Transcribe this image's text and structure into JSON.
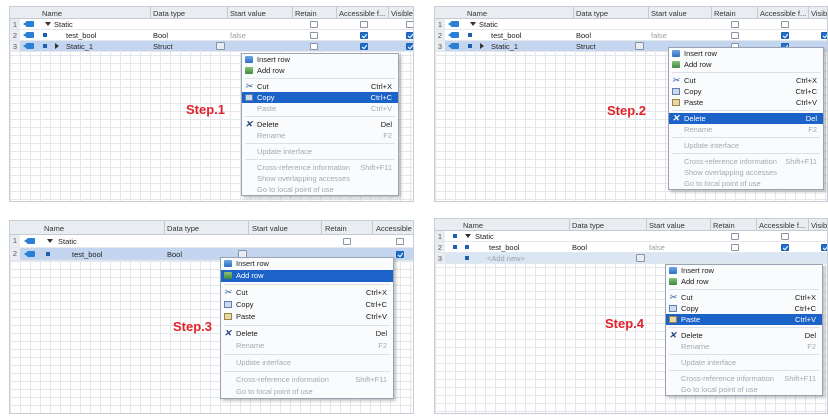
{
  "headers": {
    "name": "Name",
    "data_type": "Data type",
    "start_value": "Start value",
    "retain": "Retain",
    "accessible": "Accessible f...",
    "accessible_p3": "Accessible",
    "visible": "Visible"
  },
  "rows": {
    "static": "Static",
    "test_bool": "test_bool",
    "bool": "Bool",
    "false": "false",
    "static_1": "Static_1",
    "struct": "Struct",
    "add_new": "<Add new>",
    "n1": "1",
    "n2": "2",
    "n3": "3"
  },
  "menu": {
    "insert_row": "Insert row",
    "add_row": "Add row",
    "cut": "Cut",
    "cut_sc": "Ctrl+X",
    "copy": "Copy",
    "copy_sc": "Ctrl+C",
    "paste": "Paste",
    "paste_sc": "Ctrl+V",
    "delete": "Delete",
    "delete_sc": "Del",
    "rename": "Rename",
    "rename_sc": "F2",
    "update_interface": "Update interface",
    "cross_ref": "Cross-reference information",
    "cross_ref_sc": "Shift+F11",
    "show_overlapping": "Show overlapping accesses",
    "go_to_local": "Go to local point of use"
  },
  "steps": {
    "s1": "Step.1",
    "s2": "Step.2",
    "s3": "Step.3",
    "s4": "Step.4"
  },
  "colors": {
    "step_red": "#e0232a",
    "menu_highlight": "#1c63c9",
    "selected_row": "#c4d6ef"
  }
}
